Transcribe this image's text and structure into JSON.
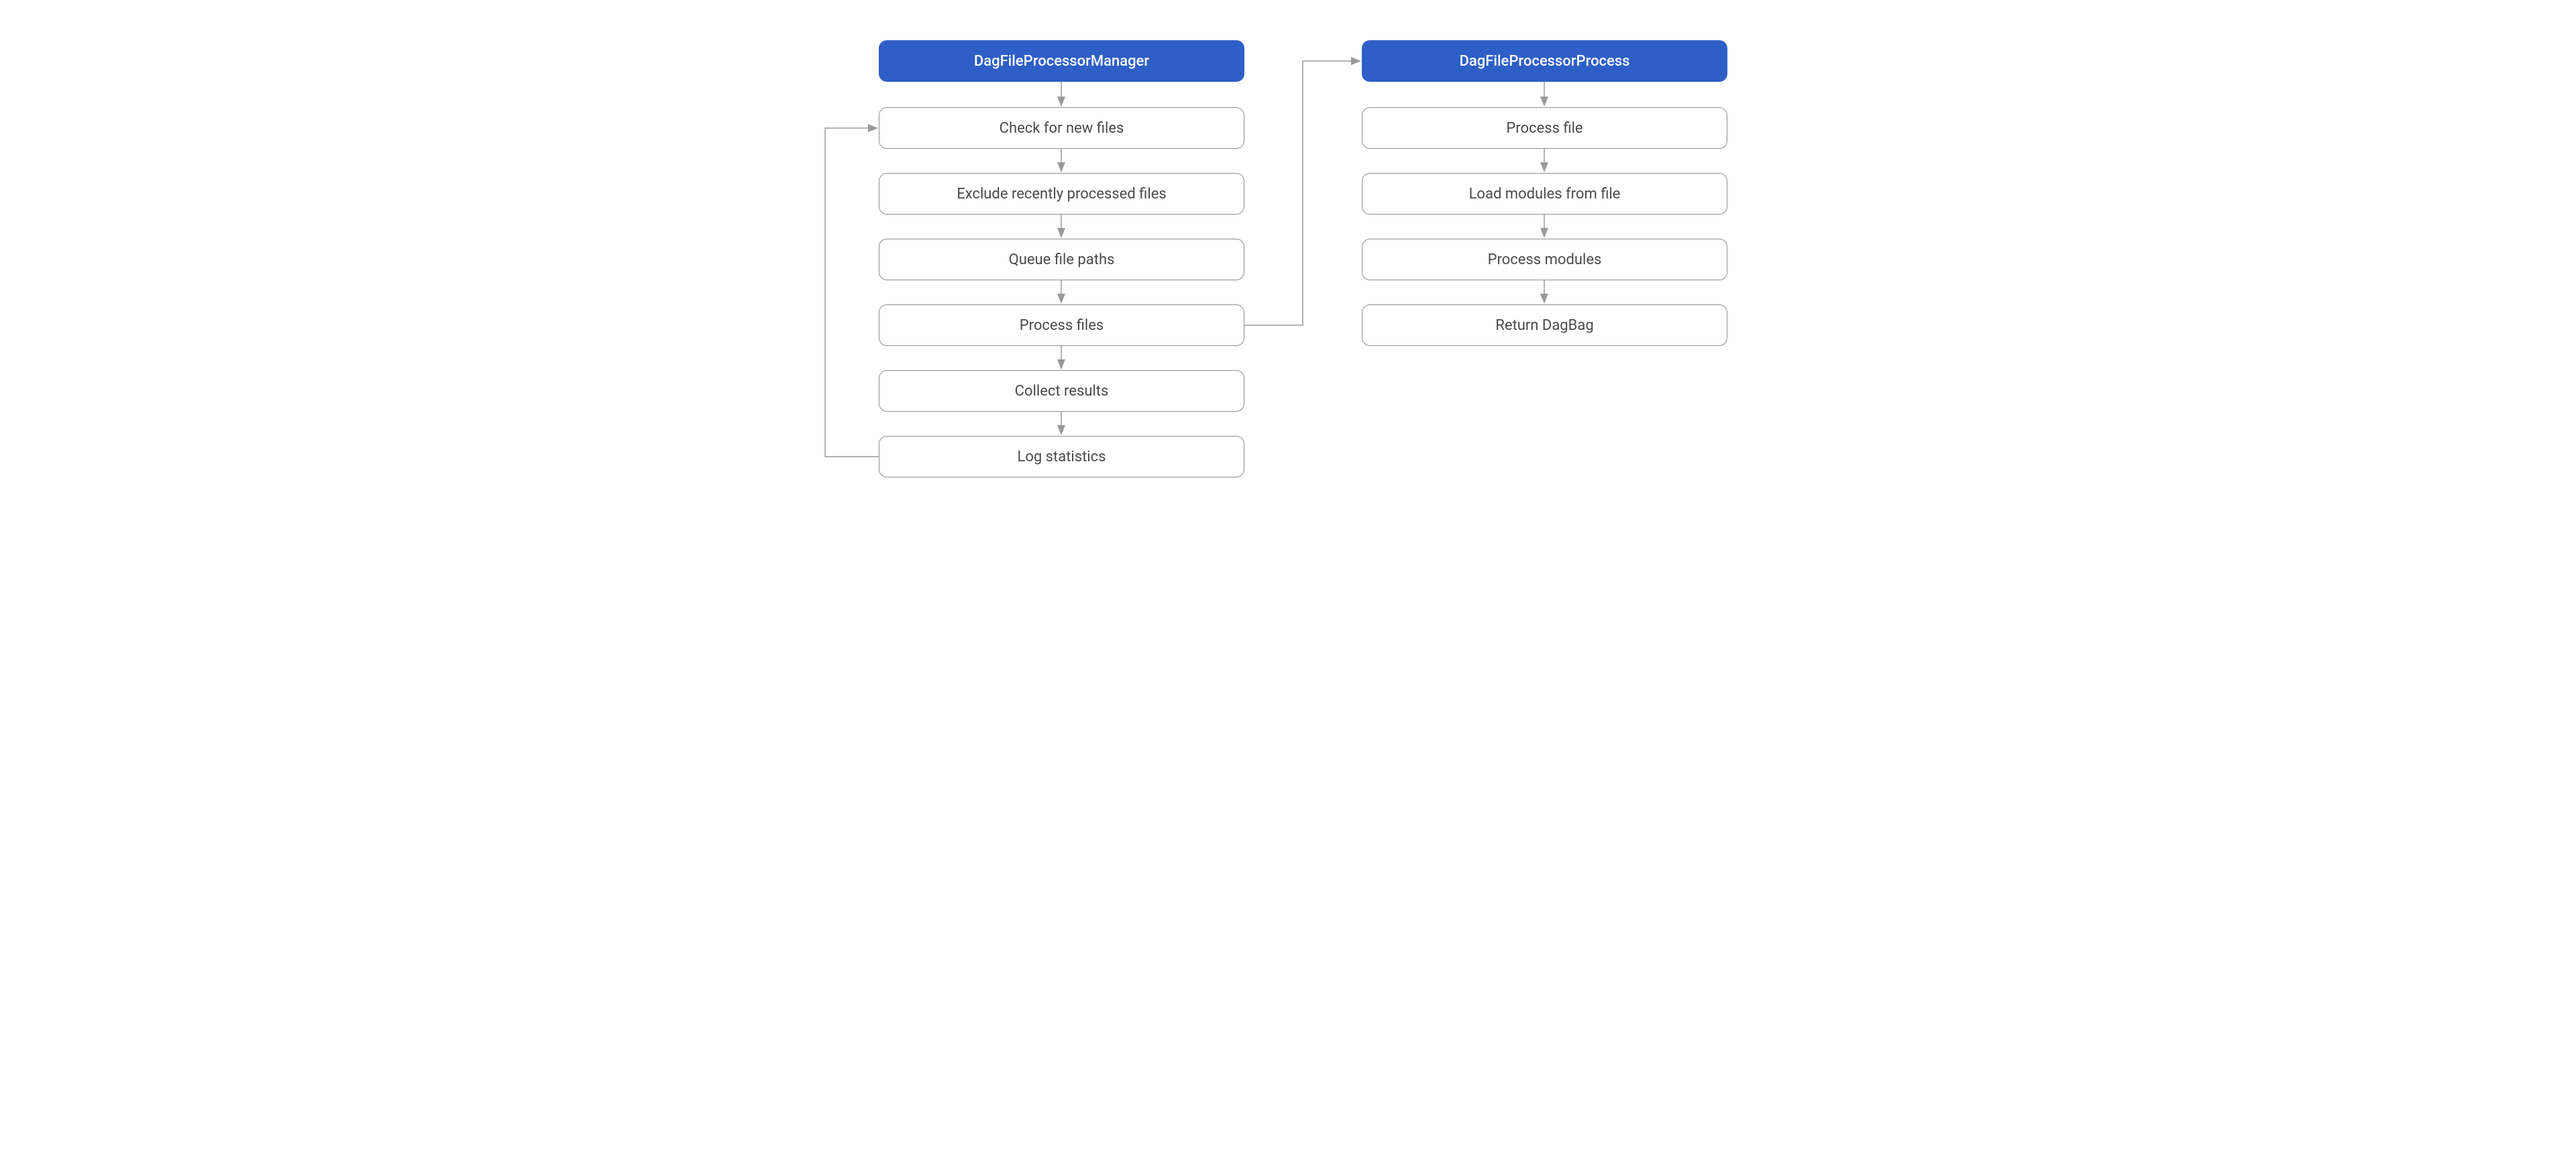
{
  "left": {
    "header": "DagFileProcessorManager",
    "steps": [
      "Check for new files",
      "Exclude recently processed files",
      "Queue file paths",
      "Process files",
      "Collect results",
      "Log statistics"
    ]
  },
  "right": {
    "header": "DagFileProcessorProcess",
    "steps": [
      "Process file",
      "Load modules from file",
      "Process modules",
      "Return DagBag"
    ]
  },
  "colors": {
    "header_bg": "#2e5fc7",
    "header_fg": "#ffffff",
    "step_border": "#8f8f8f",
    "step_fg": "#4a4a4a",
    "arrow": "#9a9a9a"
  }
}
